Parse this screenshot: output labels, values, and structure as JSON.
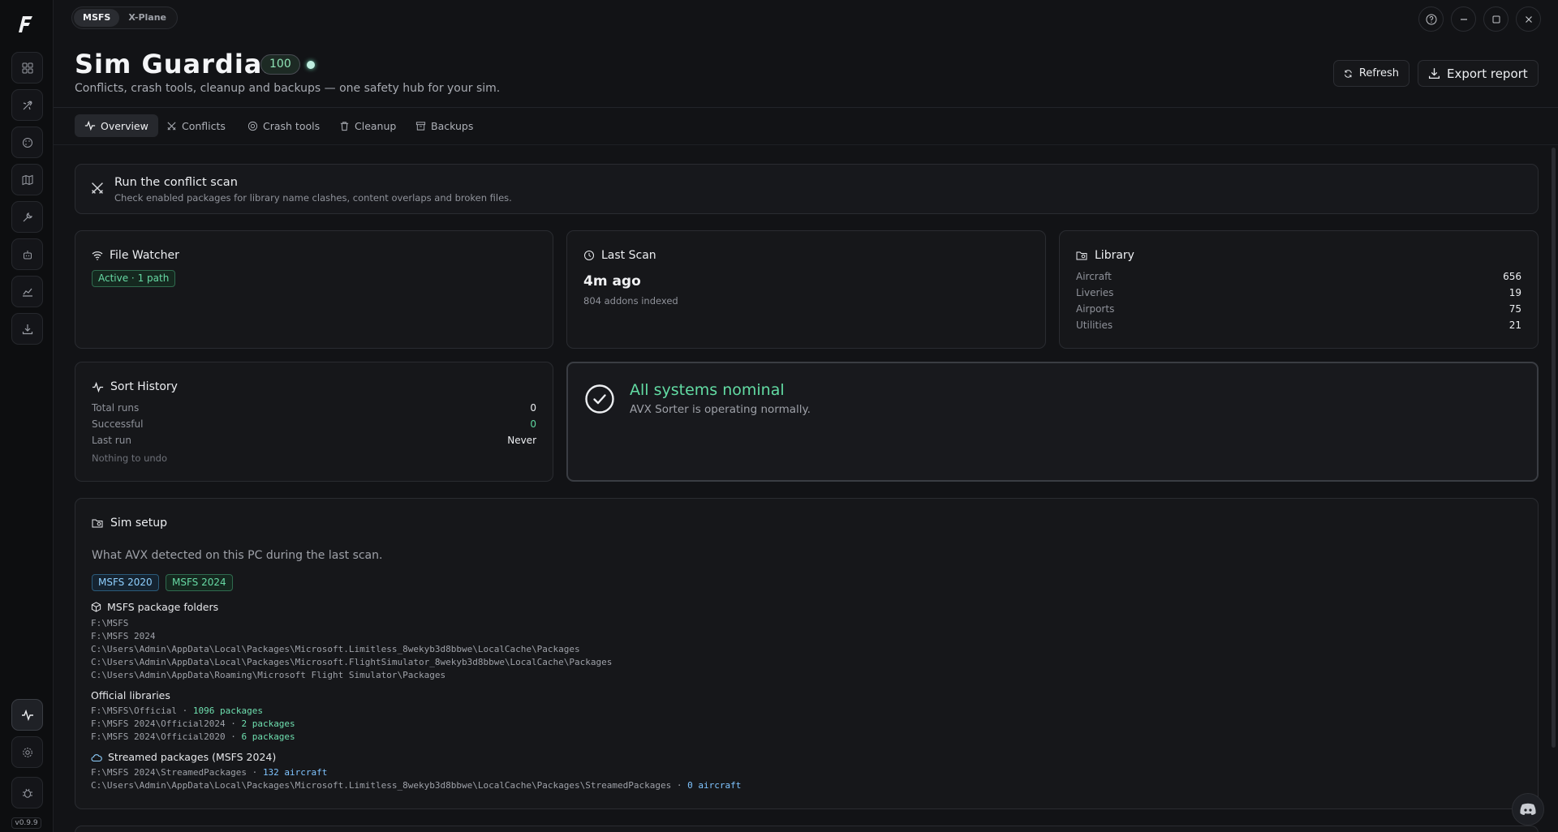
{
  "app": {
    "version": "v0.9.9",
    "sim_options": [
      "MSFS",
      "X-Plane"
    ],
    "selected_sim": "MSFS"
  },
  "header": {
    "title": "Sim Guardian",
    "score": "100",
    "subtitle": "Conflicts, crash tools, cleanup and backups — one safety hub for your sim.",
    "refresh_label": "Refresh",
    "export_label": "Export report"
  },
  "tabs": [
    {
      "label": "Overview",
      "icon": "pulse-icon"
    },
    {
      "label": "Conflicts",
      "icon": "swords-icon"
    },
    {
      "label": "Crash tools",
      "icon": "lifebuoy-icon"
    },
    {
      "label": "Cleanup",
      "icon": "trash-icon"
    },
    {
      "label": "Backups",
      "icon": "archive-icon"
    }
  ],
  "scan_banner": {
    "title": "Run the conflict scan",
    "description": "Check enabled packages for library name clashes, content overlaps and broken files."
  },
  "file_watcher": {
    "title": "File Watcher",
    "status": "Active · 1 path"
  },
  "last_scan": {
    "title": "Last Scan",
    "value": "4m ago",
    "detail": "804 addons indexed"
  },
  "library": {
    "title": "Library",
    "rows": [
      {
        "label": "Aircraft",
        "value": "656"
      },
      {
        "label": "Liveries",
        "value": "19"
      },
      {
        "label": "Airports",
        "value": "75"
      },
      {
        "label": "Utilities",
        "value": "21"
      }
    ]
  },
  "sort_history": {
    "title": "Sort History",
    "rows": [
      {
        "label": "Total runs",
        "value": "0"
      },
      {
        "label": "Successful",
        "value": "0"
      },
      {
        "label": "Last run",
        "value": "Never"
      }
    ],
    "note": "Nothing to undo"
  },
  "status_panel": {
    "title": "All systems nominal",
    "message": "AVX Sorter is operating normally."
  },
  "sim_setup": {
    "title": "Sim setup",
    "description": "What AVX detected on this PC during the last scan.",
    "chips": [
      "MSFS 2020",
      "MSFS 2024"
    ],
    "package_folders_label": "MSFS package folders",
    "package_folders": [
      "F:\\MSFS",
      "F:\\MSFS 2024",
      "C:\\Users\\Admin\\AppData\\Local\\Packages\\Microsoft.Limitless_8wekyb3d8bbwe\\LocalCache\\Packages",
      "C:\\Users\\Admin\\AppData\\Local\\Packages\\Microsoft.FlightSimulator_8wekyb3d8bbwe\\LocalCache\\Packages",
      "C:\\Users\\Admin\\AppData\\Roaming\\Microsoft Flight Simulator\\Packages"
    ],
    "official_label": "Official libraries",
    "official": [
      {
        "path": "F:\\MSFS\\Official",
        "count": "1096 packages"
      },
      {
        "path": "F:\\MSFS 2024\\Official2024",
        "count": "2 packages"
      },
      {
        "path": "F:\\MSFS 2024\\Official2020",
        "count": "6 packages"
      }
    ],
    "streamed_label": "Streamed packages (MSFS 2024)",
    "streamed": [
      {
        "path": "F:\\MSFS 2024\\StreamedPackages",
        "count": "132 aircraft"
      },
      {
        "path": "C:\\Users\\Admin\\AppData\\Local\\Packages\\Microsoft.Limitless_8wekyb3d8bbwe\\LocalCache\\Packages\\StreamedPackages",
        "count": "0 aircraft"
      }
    ]
  },
  "sidebar": {
    "items": [
      "dashboard-icon",
      "plane-icon",
      "palette-icon",
      "map-icon",
      "wrench-icon",
      "robot-icon",
      "chart-icon",
      "download-icon"
    ],
    "bottom_items": [
      "pulse-icon",
      "settings-icon",
      "bug-icon"
    ]
  },
  "colors": {
    "accent_green": "#5fd7a0",
    "background": "#121316",
    "card": "#16171a"
  }
}
